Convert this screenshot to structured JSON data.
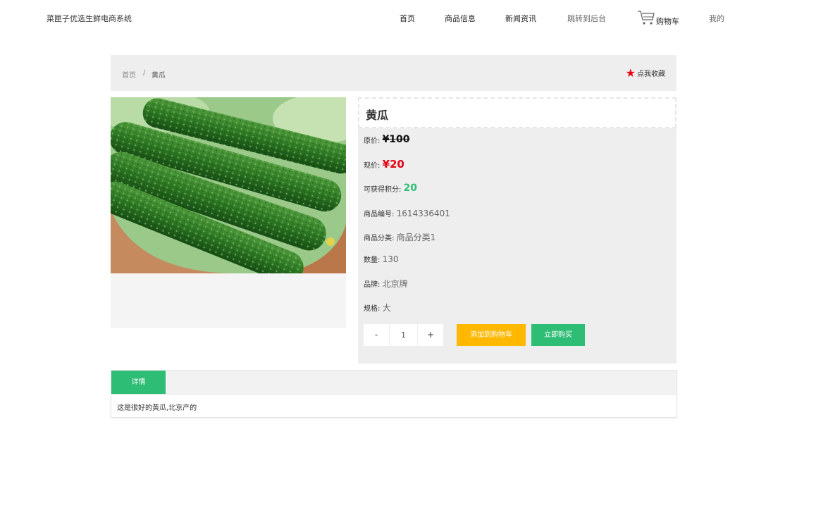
{
  "header": {
    "site_title": "菜匣子优选生鲜电商系统",
    "nav": {
      "home": "首页",
      "goods": "商品信息",
      "news": "新闻资讯",
      "admin": "跳转到后台",
      "cart": "购物车",
      "mine": "我的"
    },
    "icons": {
      "cart": "shopping-cart-icon"
    }
  },
  "breadcrumb": {
    "home": "首页",
    "separator": "/",
    "current": "黄瓜",
    "favorite": "点我收藏",
    "favorite_icon": "star-icon",
    "favorite_color": "#e60012"
  },
  "product": {
    "image_alt": "黄瓜",
    "name": "黄瓜",
    "original_price_label": "原价:",
    "original_price": "¥100",
    "current_price_label": "现价:",
    "current_price": "¥20",
    "points_label": "可获得积分:",
    "points": "20",
    "code_label": "商品编号:",
    "code": "1614336401",
    "category_label": "商品分类:",
    "category": "商品分类1",
    "quantity_label": "数量:",
    "quantity": "130",
    "brand_label": "品牌:",
    "brand": "北京牌",
    "spec_label": "规格:",
    "spec": "大"
  },
  "purchase": {
    "minus": "-",
    "qty_value": "1",
    "plus": "+",
    "add_to_cart": "添加到购物车",
    "buy_now": "立即购买",
    "add_color": "#ffb800",
    "buy_color": "#2ebd74"
  },
  "tabs": {
    "detail": "详情",
    "content": "这是很好的黄瓜,北京产的"
  },
  "colors": {
    "accent": "#2ebd74",
    "price": "#e60012"
  }
}
